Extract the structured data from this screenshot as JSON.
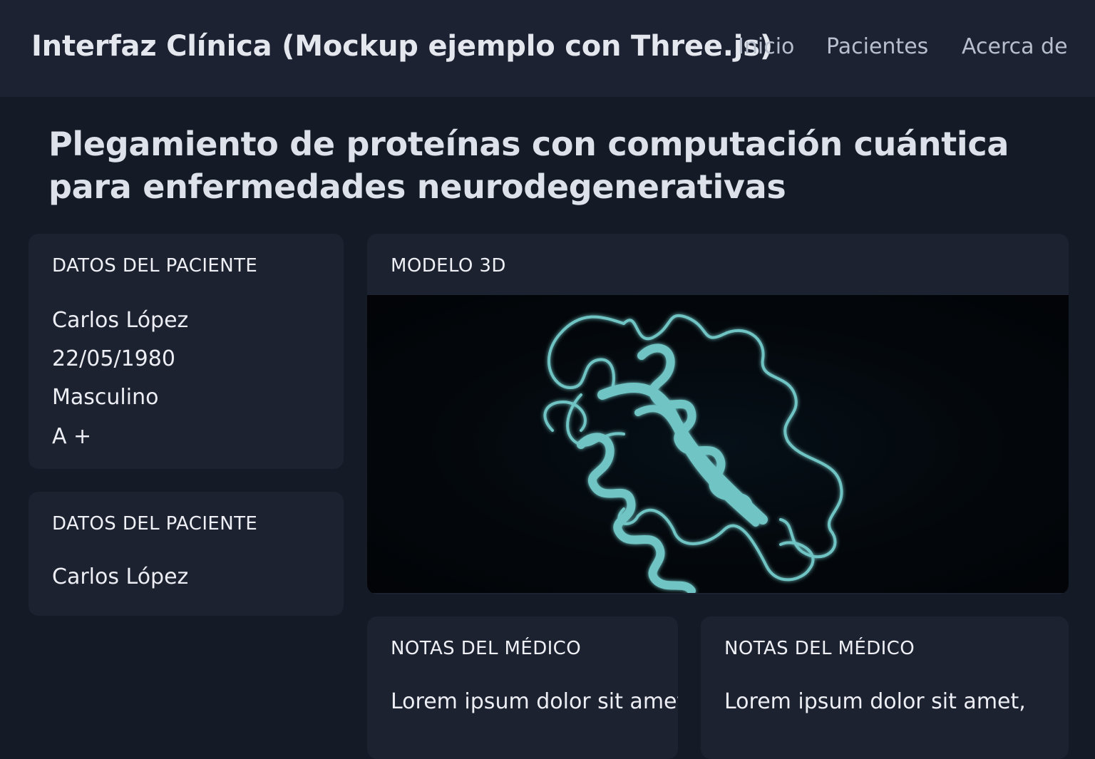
{
  "header": {
    "app_title": "Interfaz Clínica (Mockup ejemplo con Three.js)",
    "nav": [
      "Inicio",
      "Pacientes",
      "Acerca de"
    ]
  },
  "page": {
    "title_line1": "Plegamiento de proteínas con computación cuántica",
    "title_line2": "para enfermedades neurodegenerativas"
  },
  "patient_card": {
    "heading": "DATOS DEL PACIENTE",
    "name": "Carlos López",
    "birthdate": "22/05/1980",
    "sex": "Masculino",
    "blood_type": "A +"
  },
  "patient_card_2": {
    "heading": "DATOS DEL PACIENTE",
    "name": "Carlos López"
  },
  "model_card": {
    "heading": "MODELO 3D",
    "ribbon_color": "#6fc4c4"
  },
  "notes_cards": [
    {
      "heading": "NOTAS DEL MÉDICO",
      "text": "Lorem ipsum dolor sit amet,"
    },
    {
      "heading": "NOTAS DEL MÉDICO",
      "text": "Lorem ipsum dolor sit amet,"
    }
  ]
}
